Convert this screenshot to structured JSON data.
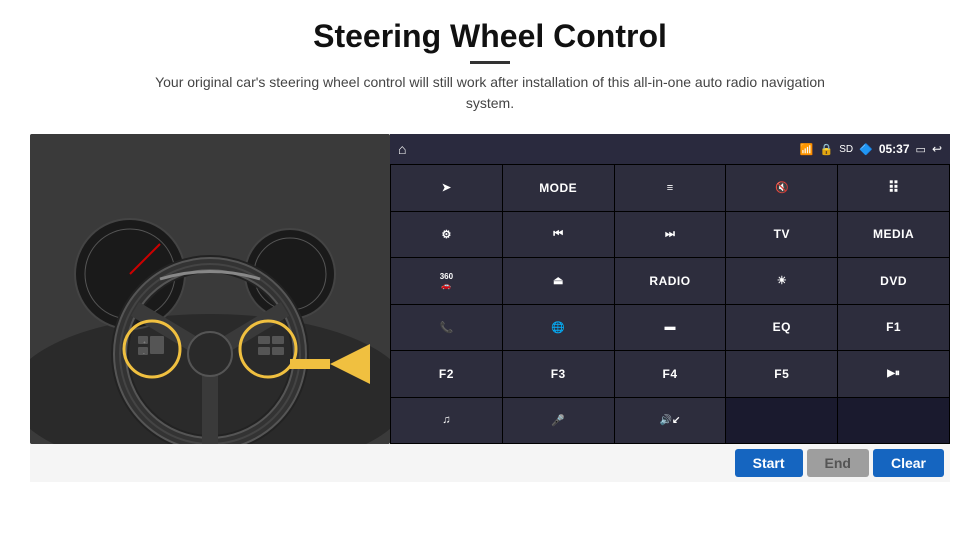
{
  "header": {
    "title": "Steering Wheel Control",
    "divider": true,
    "subtitle": "Your original car's steering wheel control will still work after installation of this all-in-one auto radio navigation system."
  },
  "status_bar": {
    "home_icon": "home",
    "wifi_icon": "wifi",
    "lock_icon": "lock",
    "sd_icon": "sd",
    "bt_icon": "bluetooth",
    "time": "05:37",
    "screen_icon": "screen",
    "back_icon": "back"
  },
  "buttons": [
    {
      "id": "nav",
      "type": "icon",
      "icon": "nav",
      "label": "NAV"
    },
    {
      "id": "mode",
      "type": "text",
      "label": "MODE"
    },
    {
      "id": "list",
      "type": "icon",
      "icon": "list",
      "label": "LIST"
    },
    {
      "id": "mute",
      "type": "icon",
      "icon": "mute",
      "label": "MUTE"
    },
    {
      "id": "apps",
      "type": "icon",
      "icon": "apps",
      "label": "APPS"
    },
    {
      "id": "settings",
      "type": "icon",
      "icon": "settings",
      "label": "SETTINGS"
    },
    {
      "id": "prev",
      "type": "icon",
      "icon": "prev",
      "label": "PREV"
    },
    {
      "id": "next",
      "type": "icon",
      "icon": "next",
      "label": "NEXT"
    },
    {
      "id": "tv",
      "type": "text",
      "label": "TV"
    },
    {
      "id": "media",
      "type": "text",
      "label": "MEDIA"
    },
    {
      "id": "360",
      "type": "icon",
      "icon": "360",
      "label": "360"
    },
    {
      "id": "eject",
      "type": "icon",
      "icon": "eject",
      "label": "EJECT"
    },
    {
      "id": "radio",
      "type": "text",
      "label": "RADIO"
    },
    {
      "id": "bright",
      "type": "icon",
      "icon": "bright",
      "label": "BRIGHT"
    },
    {
      "id": "dvd",
      "type": "text",
      "label": "DVD"
    },
    {
      "id": "phone",
      "type": "icon",
      "icon": "phone",
      "label": "PHONE"
    },
    {
      "id": "browser",
      "type": "icon",
      "icon": "browser",
      "label": "BROWSER"
    },
    {
      "id": "screen",
      "type": "icon",
      "icon": "screen",
      "label": "SCREEN"
    },
    {
      "id": "eq",
      "type": "text",
      "label": "EQ"
    },
    {
      "id": "f1",
      "type": "text",
      "label": "F1"
    },
    {
      "id": "f2",
      "type": "text",
      "label": "F2"
    },
    {
      "id": "f3",
      "type": "text",
      "label": "F3"
    },
    {
      "id": "f4",
      "type": "text",
      "label": "F4"
    },
    {
      "id": "f5",
      "type": "text",
      "label": "F5"
    },
    {
      "id": "playpause",
      "type": "icon",
      "icon": "playpause",
      "label": "PLAY/PAUSE"
    },
    {
      "id": "music",
      "type": "icon",
      "icon": "music",
      "label": "MUSIC"
    },
    {
      "id": "mic",
      "type": "icon",
      "icon": "mic",
      "label": "MIC"
    },
    {
      "id": "vol",
      "type": "icon",
      "icon": "vol",
      "label": "VOL"
    }
  ],
  "action_bar": {
    "start_label": "Start",
    "end_label": "End",
    "clear_label": "Clear"
  }
}
